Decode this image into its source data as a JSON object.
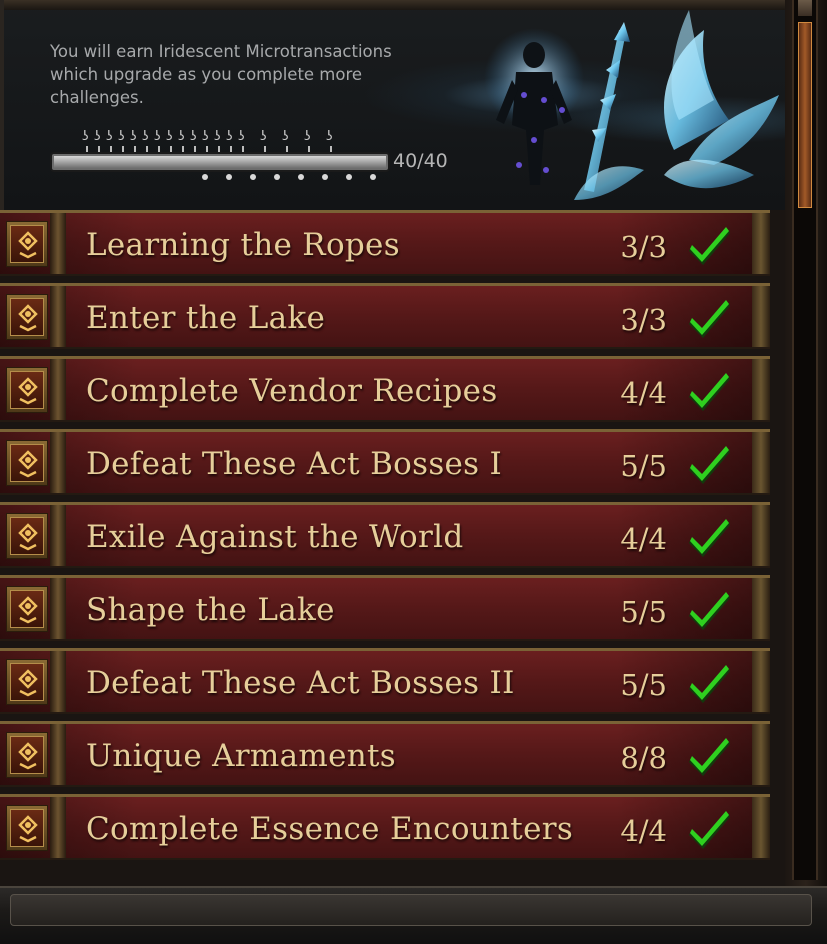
{
  "header": {
    "description": "You will earn Iridescent Microtransactions which upgrade as you complete more challenges.",
    "progress_text": "40/40",
    "progress_fraction": 1.0,
    "reward_marker_glyph": "ʖ",
    "preview_icon": "armor-and-wings-preview"
  },
  "challenges": [
    {
      "title": "Learning the Ropes",
      "progress": "3/3",
      "completed": true
    },
    {
      "title": "Enter the Lake",
      "progress": "3/3",
      "completed": true
    },
    {
      "title": "Complete Vendor Recipes",
      "progress": "4/4",
      "completed": true
    },
    {
      "title": "Defeat These Act Bosses I",
      "progress": "5/5",
      "completed": true
    },
    {
      "title": "Exile Against the World",
      "progress": "4/4",
      "completed": true
    },
    {
      "title": "Shape the Lake",
      "progress": "5/5",
      "completed": true
    },
    {
      "title": "Defeat These Act Bosses II",
      "progress": "5/5",
      "completed": true
    },
    {
      "title": "Unique Armaments",
      "progress": "8/8",
      "completed": true
    },
    {
      "title": "Complete Essence Encounters",
      "progress": "4/4",
      "completed": true
    }
  ],
  "colors": {
    "title_text": "#e6ce9a",
    "check": "#2fd01f",
    "row_red": "#5a1a1a",
    "gold_trim": "#7a6236"
  },
  "icons": {
    "row": "challenge-badge-icon",
    "check": "checkmark-icon"
  }
}
